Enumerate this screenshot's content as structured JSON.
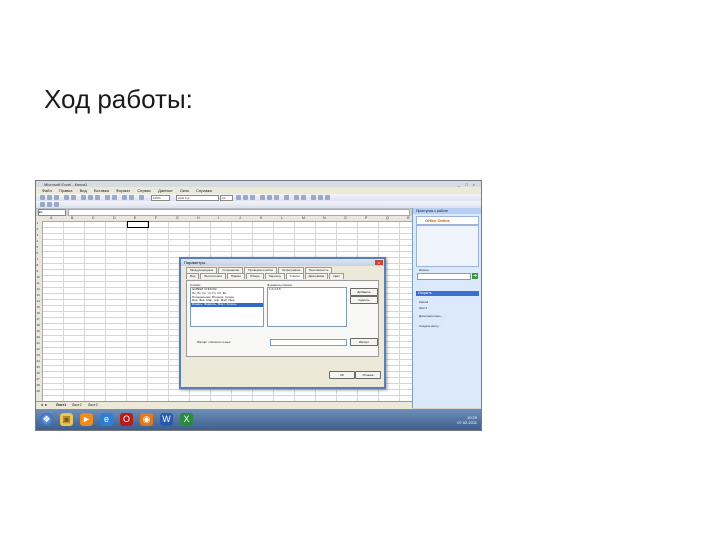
{
  "slide": {
    "title": "Ход работы:"
  },
  "window": {
    "title": "Microsoft Excel - Книга1",
    "controls": "_ □ ×",
    "menu": [
      "Файл",
      "Правка",
      "Вид",
      "Вставка",
      "Формат",
      "Сервис",
      "Данные",
      "Окно",
      "Справка"
    ],
    "help_placeholder": "Введите вопрос",
    "zoom": "100%",
    "font_name": "Arial Cyr",
    "font_size": "10",
    "name_box": "E1"
  },
  "columns": [
    "A",
    "B",
    "C",
    "D",
    "E",
    "F",
    "G",
    "H",
    "I",
    "J",
    "K",
    "L",
    "M",
    "N",
    "O",
    "P",
    "Q",
    "R"
  ],
  "rows": [
    "1",
    "2",
    "3",
    "4",
    "5",
    "6",
    "7",
    "8",
    "9",
    "10",
    "11",
    "12",
    "13",
    "14",
    "15",
    "16",
    "17",
    "18",
    "19",
    "20",
    "21",
    "22",
    "23",
    "24",
    "25",
    "26",
    "27",
    "28",
    "29"
  ],
  "sheet_tabs": [
    "Лист1",
    "Лист2",
    "Лист3"
  ],
  "task_pane": {
    "header": "Приступая к работе",
    "office_logo": "Office Online",
    "search_label": "Искать:",
    "open_header": "Открыть",
    "files": [
      "Книга1",
      "Лист1"
    ],
    "more": "Дополнительно...",
    "create": "Создать книгу..."
  },
  "dialog": {
    "title": "Параметры",
    "close": "×",
    "tabs_row1": [
      "Международные",
      "Сохранение",
      "Проверка ошибок",
      "Орфография",
      "Безопасность"
    ],
    "tabs_row2": [
      "Вид",
      "Вычисления",
      "Правка",
      "Общие",
      "Переход",
      "Списки",
      "Диаграмма",
      "Цвет"
    ],
    "lists_label": "Списки:",
    "items_label": "Элементы списка:",
    "lists": [
      "НОВЫЙ СПИСОК",
      "Пн, Вт, Ср, Чт, Пт, Сб, Вс",
      "Понедельник, Вторник, Среда",
      "Янв, Фев, Мар, Апр, Май, Июн",
      "Январь, Февраль, Март, Апрель"
    ],
    "selected_list_index": 4,
    "items_value": "1;2;3;4;5",
    "add_button": "Добавить",
    "delete_button": "Удалить",
    "import_label": "Импорт списка из ячеек:",
    "import_button": "Импорт",
    "ok_button": "ОК",
    "cancel_button": "Отмена"
  },
  "taskbar": {
    "time": "10:29",
    "date": "07.02.2011",
    "icons": [
      "start-icon",
      "folder-icon",
      "media-player-icon",
      "ie-icon",
      "opera-icon",
      "firefox-icon",
      "word-icon",
      "excel-icon"
    ]
  },
  "colors": {
    "titlebar": "#d7dbe2",
    "dialog_border": "#5a7fb8",
    "taskbar": "#3c5f8f",
    "pane": "#dce8fb"
  }
}
